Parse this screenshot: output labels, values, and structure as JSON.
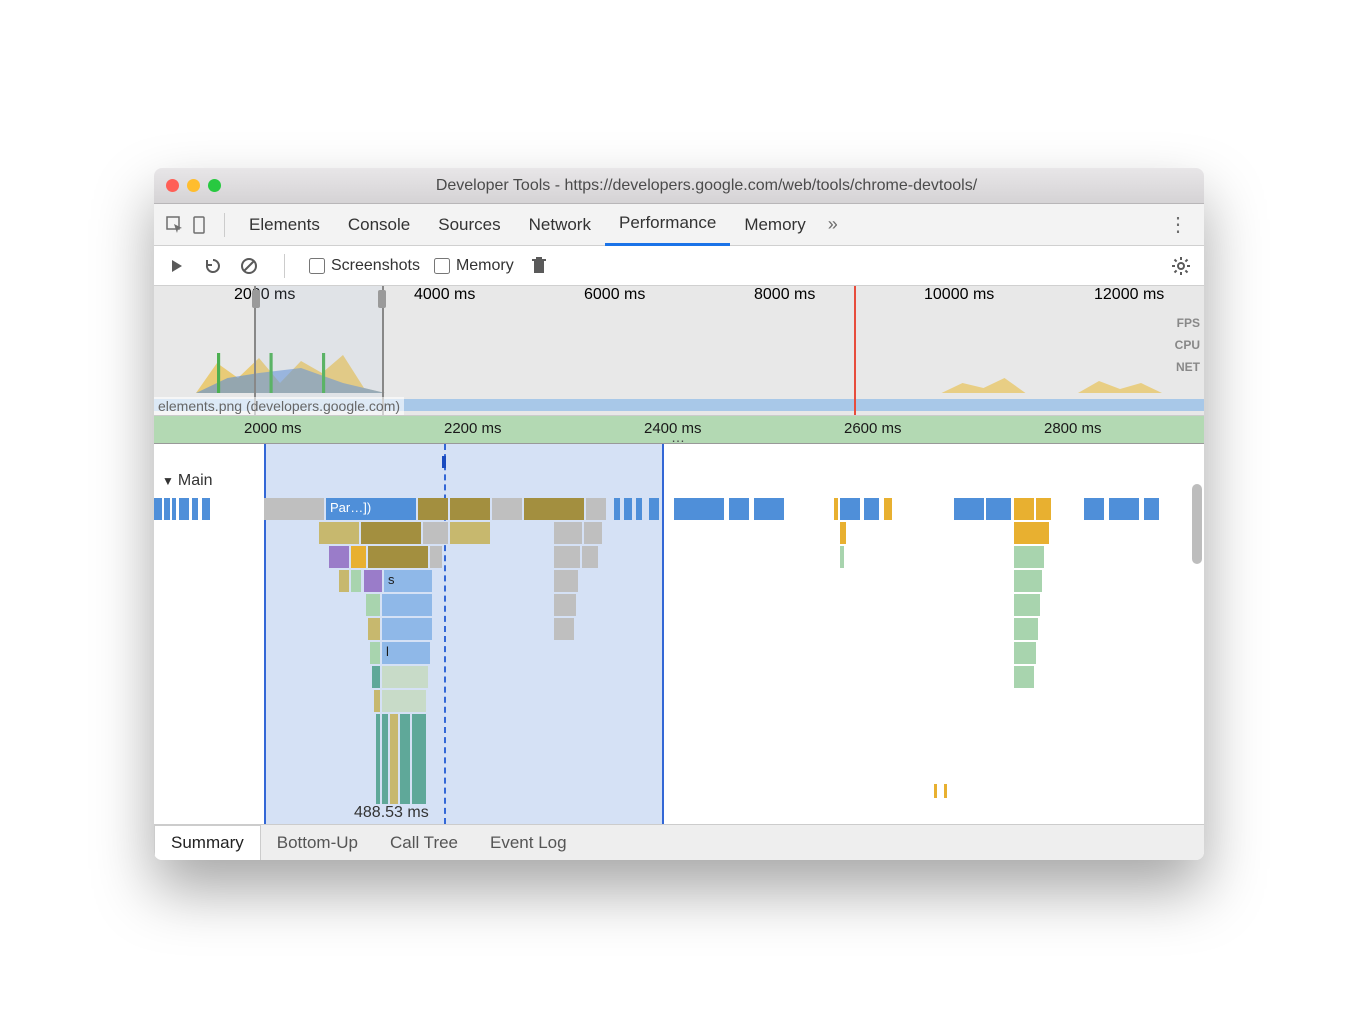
{
  "window": {
    "title": "Developer Tools - https://developers.google.com/web/tools/chrome-devtools/"
  },
  "tabs": {
    "items": [
      "Elements",
      "Console",
      "Sources",
      "Network",
      "Performance",
      "Memory"
    ],
    "active": "Performance"
  },
  "controls": {
    "screenshots": "Screenshots",
    "memory": "Memory"
  },
  "overview": {
    "ticks": [
      "2000 ms",
      "4000 ms",
      "6000 ms",
      "8000 ms",
      "10000 ms",
      "12000 ms"
    ],
    "labels": [
      "FPS",
      "CPU",
      "NET"
    ],
    "file": "elements.png (developers.google.com)"
  },
  "ruler2": {
    "ticks": [
      "2000 ms",
      "2200 ms",
      "2400 ms",
      "2600 ms",
      "2800 ms"
    ]
  },
  "flame": {
    "section": "Main",
    "task_label": "Par…])",
    "s_label": "s",
    "l_label": "l",
    "duration": "488.53 ms"
  },
  "bottom_tabs": {
    "items": [
      "Summary",
      "Bottom-Up",
      "Call Tree",
      "Event Log"
    ],
    "active": "Summary"
  },
  "colors": {
    "script": "#4f8fd9",
    "scriptLight": "#8fb8e8",
    "render": "#a38f3f",
    "renderLight": "#c7b86e",
    "paint": "#6fb87a",
    "paintLight": "#a8d4ae",
    "system": "#bfbfbf",
    "idle": "#e0e0e0",
    "purple": "#9a7cc9"
  }
}
